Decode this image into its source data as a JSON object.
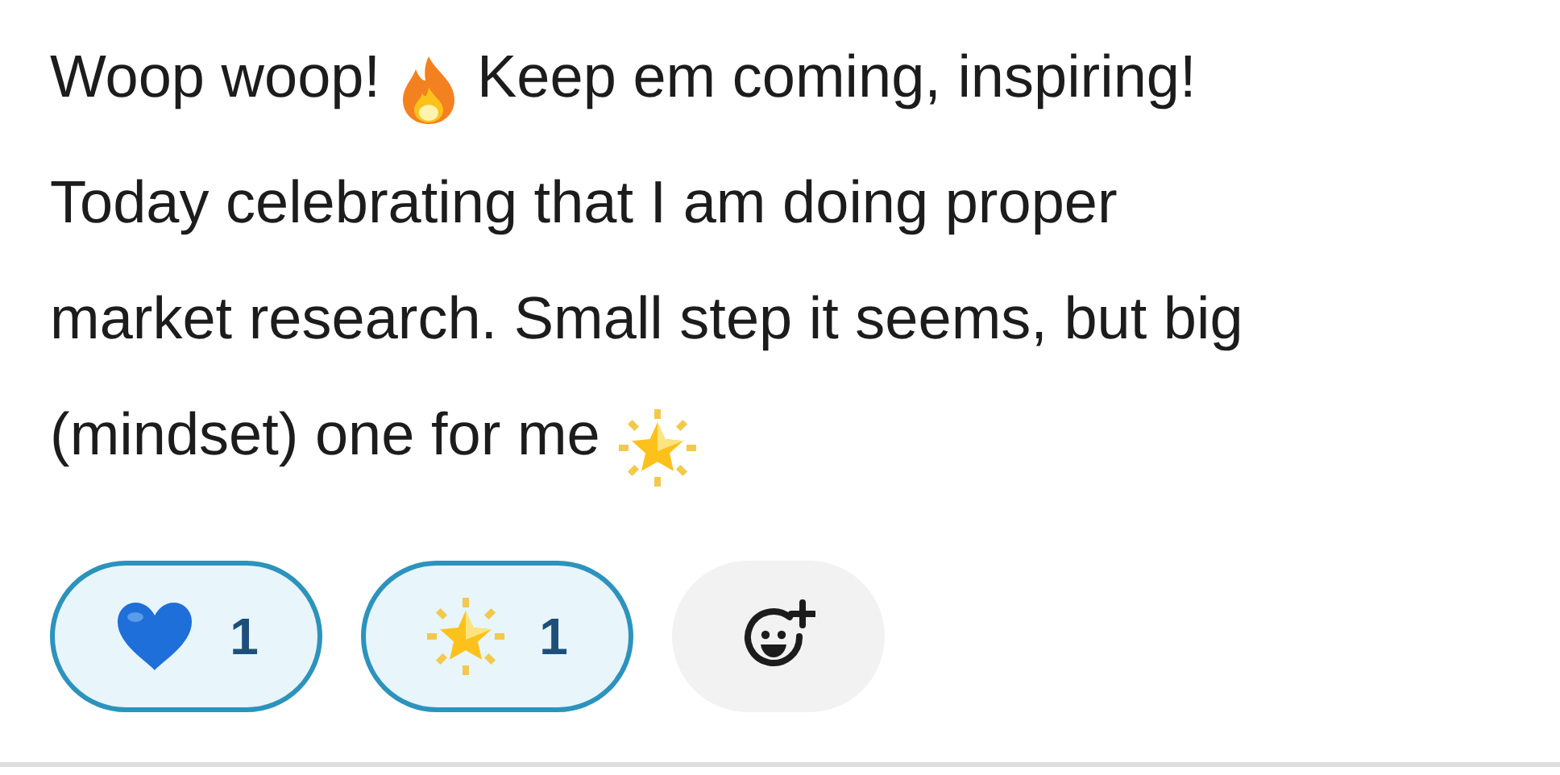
{
  "message": {
    "segments": [
      {
        "kind": "text",
        "text": "Woop woop!"
      },
      {
        "kind": "fire"
      },
      {
        "kind": "text",
        "text": "Keep em coming, inspiring!"
      },
      {
        "kind": "break"
      },
      {
        "kind": "text",
        "text": "Today celebrating that I am doing proper"
      },
      {
        "kind": "break"
      },
      {
        "kind": "text",
        "text": "market research. Small step it seems, but big"
      },
      {
        "kind": "break"
      },
      {
        "kind": "text",
        "text": "(mindset) one for me"
      },
      {
        "kind": "star"
      }
    ]
  },
  "reactions": [
    {
      "kind": "heart",
      "count": "1",
      "selected": true
    },
    {
      "kind": "star",
      "count": "1",
      "selected": true
    }
  ],
  "add_reaction": {
    "kind": "add"
  }
}
